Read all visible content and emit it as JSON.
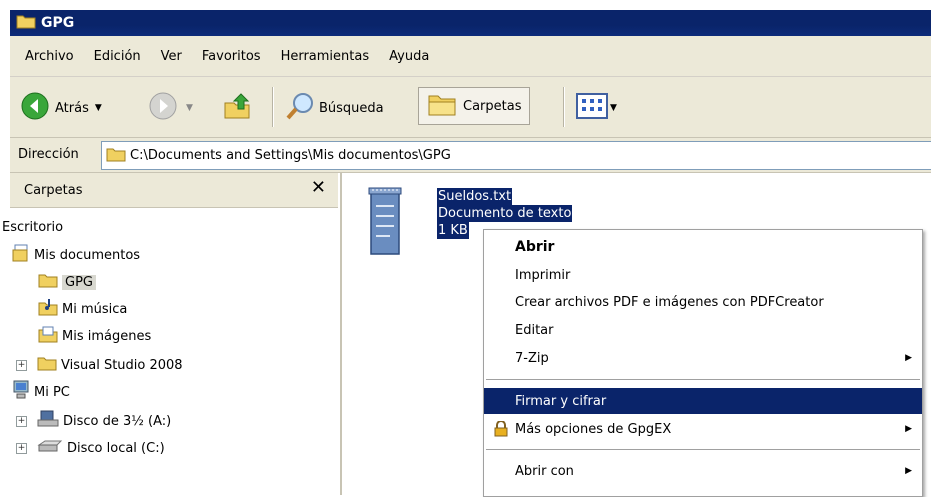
{
  "window": {
    "title": "GPG"
  },
  "menu": [
    "Archivo",
    "Edición",
    "Ver",
    "Favoritos",
    "Herramientas",
    "Ayuda"
  ],
  "toolbar": {
    "back_label": "Atrás",
    "search_label": "Búsqueda",
    "folders_label": "Carpetas"
  },
  "address": {
    "label": "Dirección",
    "path": "C:\\Documents and Settings\\Mis documentos\\GPG"
  },
  "folders_pane": {
    "title": "Carpetas",
    "items": [
      {
        "label": "Escritorio",
        "level": 0,
        "expander": ""
      },
      {
        "label": "Mis documentos",
        "level": 0,
        "expander": ""
      },
      {
        "label": "GPG",
        "level": 1,
        "expander": "",
        "selected": true
      },
      {
        "label": "Mi música",
        "level": 1,
        "expander": ""
      },
      {
        "label": "Mis imágenes",
        "level": 1,
        "expander": ""
      },
      {
        "label": "Visual Studio 2008",
        "level": 1,
        "expander": "+"
      },
      {
        "label": "Mi PC",
        "level": 0,
        "expander": ""
      },
      {
        "label": "Disco de 3½ (A:)",
        "level": 1,
        "expander": "+"
      },
      {
        "label": "Disco local (C:)",
        "level": 1,
        "expander": "+"
      }
    ]
  },
  "file": {
    "name": "Sueldos.txt",
    "type": "Documento de texto",
    "size": "1 KB"
  },
  "context_menu": {
    "items": [
      {
        "label": "Abrir",
        "bold": true,
        "submenu": false
      },
      {
        "label": "Imprimir",
        "submenu": false
      },
      {
        "label": "Crear archivos PDF e imágenes con PDFCreator",
        "submenu": false
      },
      {
        "label": "Editar",
        "submenu": false
      },
      {
        "label": "7-Zip",
        "submenu": true
      },
      {
        "label": "Firmar y cifrar",
        "highlighted": true,
        "submenu": false
      },
      {
        "label": "Más opciones de GpgEX",
        "submenu": true,
        "icon": "lock-icon"
      },
      {
        "label": "Abrir con",
        "submenu": true
      }
    ]
  },
  "colors": {
    "titlebar": "#0a246a",
    "chrome": "#ece9d8",
    "selection": "#0a246a"
  }
}
